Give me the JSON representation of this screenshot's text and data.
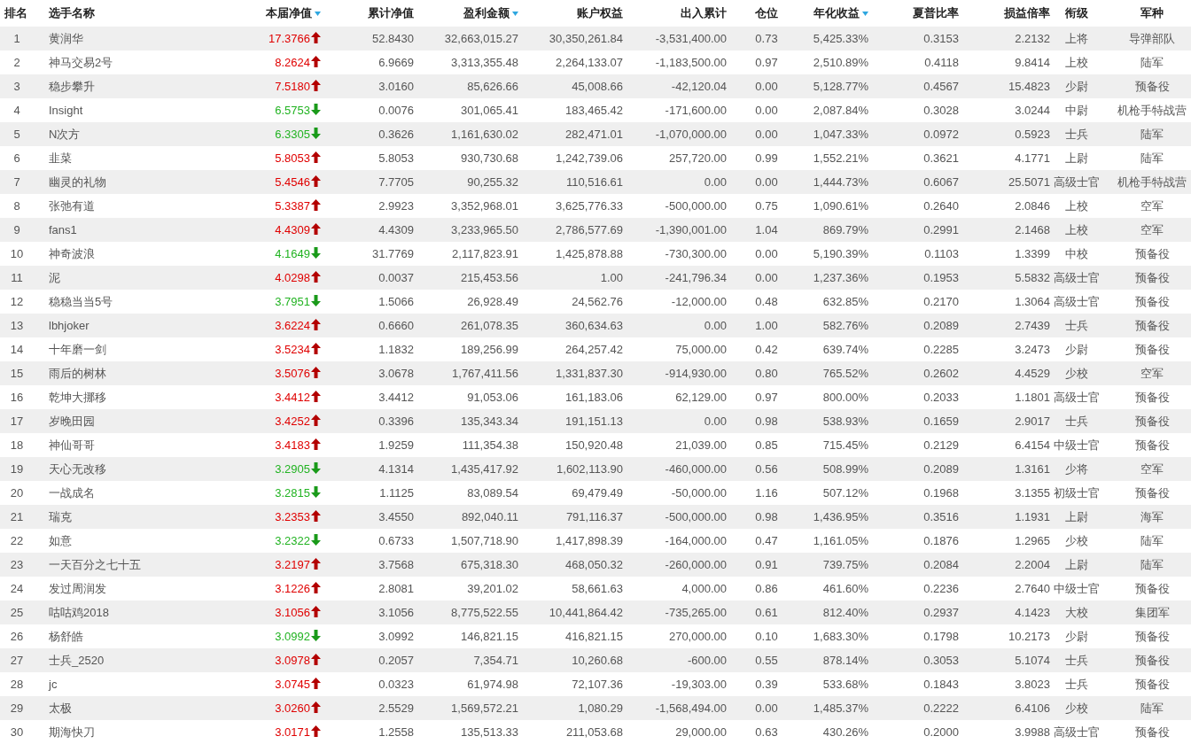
{
  "table": {
    "columns": [
      {
        "label": "排名",
        "sort_icon": false
      },
      {
        "label": "选手名称",
        "sort_icon": false
      },
      {
        "label": "本届净值",
        "sort_icon": true
      },
      {
        "label": "累计净值",
        "sort_icon": false
      },
      {
        "label": "盈利金额",
        "sort_icon": true
      },
      {
        "label": "账户权益",
        "sort_icon": false
      },
      {
        "label": "出入累计",
        "sort_icon": false
      },
      {
        "label": "仓位",
        "sort_icon": false
      },
      {
        "label": "年化收益",
        "sort_icon": true
      },
      {
        "label": "夏普比率",
        "sort_icon": false
      },
      {
        "label": "损益倍率",
        "sort_icon": false
      },
      {
        "label": "衔级",
        "sort_icon": false
      },
      {
        "label": "军种",
        "sort_icon": false
      }
    ],
    "rows": [
      {
        "rising": true,
        "cells": [
          "1",
          "黄润华",
          "17.3766",
          "52.8430",
          "32,663,015.27",
          "30,350,261.84",
          "-3,531,400.00",
          "0.73",
          "5,425.33%",
          "0.3153",
          "2.2132",
          "上将",
          "导弹部队"
        ]
      },
      {
        "rising": true,
        "cells": [
          "2",
          "神马交易2号",
          "8.2624",
          "6.9669",
          "3,313,355.48",
          "2,264,133.07",
          "-1,183,500.00",
          "0.97",
          "2,510.89%",
          "0.4118",
          "9.8414",
          "上校",
          "陆军"
        ]
      },
      {
        "rising": true,
        "cells": [
          "3",
          "稳步攀升",
          "7.5180",
          "3.0160",
          "85,626.66",
          "45,008.66",
          "-42,120.04",
          "0.00",
          "5,128.77%",
          "0.4567",
          "15.4823",
          "少尉",
          "预备役"
        ]
      },
      {
        "rising": false,
        "cells": [
          "4",
          "Insight",
          "6.5753",
          "0.0076",
          "301,065.41",
          "183,465.42",
          "-171,600.00",
          "0.00",
          "2,087.84%",
          "0.3028",
          "3.0244",
          "中尉",
          "机枪手特战营"
        ]
      },
      {
        "rising": false,
        "cells": [
          "5",
          "N次方",
          "6.3305",
          "0.3626",
          "1,161,630.02",
          "282,471.01",
          "-1,070,000.00",
          "0.00",
          "1,047.33%",
          "0.0972",
          "0.5923",
          "士兵",
          "陆军"
        ]
      },
      {
        "rising": true,
        "cells": [
          "6",
          "韭菜",
          "5.8053",
          "5.8053",
          "930,730.68",
          "1,242,739.06",
          "257,720.00",
          "0.99",
          "1,552.21%",
          "0.3621",
          "4.1771",
          "上尉",
          "陆军"
        ]
      },
      {
        "rising": true,
        "cells": [
          "7",
          "幽灵的礼物",
          "5.4546",
          "7.7705",
          "90,255.32",
          "110,516.61",
          "0.00",
          "0.00",
          "1,444.73%",
          "0.6067",
          "25.5071",
          "高级士官",
          "机枪手特战营"
        ]
      },
      {
        "rising": true,
        "cells": [
          "8",
          "张弛有道",
          "5.3387",
          "2.9923",
          "3,352,968.01",
          "3,625,776.33",
          "-500,000.00",
          "0.75",
          "1,090.61%",
          "0.2640",
          "2.0846",
          "上校",
          "空军"
        ]
      },
      {
        "rising": true,
        "cells": [
          "9",
          "fans1",
          "4.4309",
          "4.4309",
          "3,233,965.50",
          "2,786,577.69",
          "-1,390,001.00",
          "1.04",
          "869.79%",
          "0.2991",
          "2.1468",
          "上校",
          "空军"
        ]
      },
      {
        "rising": false,
        "cells": [
          "10",
          "神奇波浪",
          "4.1649",
          "31.7769",
          "2,117,823.91",
          "1,425,878.88",
          "-730,300.00",
          "0.00",
          "5,190.39%",
          "0.1103",
          "1.3399",
          "中校",
          "预备役"
        ]
      },
      {
        "rising": true,
        "cells": [
          "11",
          "泥",
          "4.0298",
          "0.0037",
          "215,453.56",
          "1.00",
          "-241,796.34",
          "0.00",
          "1,237.36%",
          "0.1953",
          "5.5832",
          "高级士官",
          "预备役"
        ]
      },
      {
        "rising": false,
        "cells": [
          "12",
          "稳稳当当5号",
          "3.7951",
          "1.5066",
          "26,928.49",
          "24,562.76",
          "-12,000.00",
          "0.48",
          "632.85%",
          "0.2170",
          "1.3064",
          "高级士官",
          "预备役"
        ]
      },
      {
        "rising": true,
        "cells": [
          "13",
          "lbhjoker",
          "3.6224",
          "0.6660",
          "261,078.35",
          "360,634.63",
          "0.00",
          "1.00",
          "582.76%",
          "0.2089",
          "2.7439",
          "士兵",
          "预备役"
        ]
      },
      {
        "rising": true,
        "cells": [
          "14",
          "十年磨一剑",
          "3.5234",
          "1.1832",
          "189,256.99",
          "264,257.42",
          "75,000.00",
          "0.42",
          "639.74%",
          "0.2285",
          "3.2473",
          "少尉",
          "预备役"
        ]
      },
      {
        "rising": true,
        "cells": [
          "15",
          "雨后的树林",
          "3.5076",
          "3.0678",
          "1,767,411.56",
          "1,331,837.30",
          "-914,930.00",
          "0.80",
          "765.52%",
          "0.2602",
          "4.4529",
          "少校",
          "空军"
        ]
      },
      {
        "rising": true,
        "cells": [
          "16",
          "乾坤大挪移",
          "3.4412",
          "3.4412",
          "91,053.06",
          "161,183.06",
          "62,129.00",
          "0.97",
          "800.00%",
          "0.2033",
          "1.1801",
          "高级士官",
          "预备役"
        ]
      },
      {
        "rising": true,
        "cells": [
          "17",
          "岁晚田园",
          "3.4252",
          "0.3396",
          "135,343.34",
          "191,151.13",
          "0.00",
          "0.98",
          "538.93%",
          "0.1659",
          "2.9017",
          "士兵",
          "预备役"
        ]
      },
      {
        "rising": true,
        "cells": [
          "18",
          "神仙哥哥",
          "3.4183",
          "1.9259",
          "111,354.38",
          "150,920.48",
          "21,039.00",
          "0.85",
          "715.45%",
          "0.2129",
          "6.4154",
          "中级士官",
          "预备役"
        ]
      },
      {
        "rising": false,
        "cells": [
          "19",
          "天心无改移",
          "3.2905",
          "4.1314",
          "1,435,417.92",
          "1,602,113.90",
          "-460,000.00",
          "0.56",
          "508.99%",
          "0.2089",
          "1.3161",
          "少将",
          "空军"
        ]
      },
      {
        "rising": false,
        "cells": [
          "20",
          "一战成名",
          "3.2815",
          "1.1125",
          "83,089.54",
          "69,479.49",
          "-50,000.00",
          "1.16",
          "507.12%",
          "0.1968",
          "3.1355",
          "初级士官",
          "预备役"
        ]
      },
      {
        "rising": true,
        "cells": [
          "21",
          "瑞克",
          "3.2353",
          "3.4550",
          "892,040.11",
          "791,116.37",
          "-500,000.00",
          "0.98",
          "1,436.95%",
          "0.3516",
          "1.1931",
          "上尉",
          "海军"
        ]
      },
      {
        "rising": false,
        "cells": [
          "22",
          "如意",
          "3.2322",
          "0.6733",
          "1,507,718.90",
          "1,417,898.39",
          "-164,000.00",
          "0.47",
          "1,161.05%",
          "0.1876",
          "1.2965",
          "少校",
          "陆军"
        ]
      },
      {
        "rising": true,
        "cells": [
          "23",
          "一天百分之七十五",
          "3.2197",
          "3.7568",
          "675,318.30",
          "468,050.32",
          "-260,000.00",
          "0.91",
          "739.75%",
          "0.2084",
          "2.2004",
          "上尉",
          "陆军"
        ]
      },
      {
        "rising": true,
        "cells": [
          "24",
          "发过周润发",
          "3.1226",
          "2.8081",
          "39,201.02",
          "58,661.63",
          "4,000.00",
          "0.86",
          "461.60%",
          "0.2236",
          "2.7640",
          "中级士官",
          "预备役"
        ]
      },
      {
        "rising": true,
        "cells": [
          "25",
          "咕咕鸡2018",
          "3.1056",
          "3.1056",
          "8,775,522.55",
          "10,441,864.42",
          "-735,265.00",
          "0.61",
          "812.40%",
          "0.2937",
          "4.1423",
          "大校",
          "集团军"
        ]
      },
      {
        "rising": false,
        "cells": [
          "26",
          "杨舒皓",
          "3.0992",
          "3.0992",
          "146,821.15",
          "416,821.15",
          "270,000.00",
          "0.10",
          "1,683.30%",
          "0.1798",
          "10.2173",
          "少尉",
          "预备役"
        ]
      },
      {
        "rising": true,
        "cells": [
          "27",
          "士兵_2520",
          "3.0978",
          "0.2057",
          "7,354.71",
          "10,260.68",
          "-600.00",
          "0.55",
          "878.14%",
          "0.3053",
          "5.1074",
          "士兵",
          "预备役"
        ]
      },
      {
        "rising": true,
        "cells": [
          "28",
          "jc",
          "3.0745",
          "0.0323",
          "61,974.98",
          "72,107.36",
          "-19,303.00",
          "0.39",
          "533.68%",
          "0.1843",
          "3.8023",
          "士兵",
          "预备役"
        ]
      },
      {
        "rising": true,
        "cells": [
          "29",
          "太极",
          "3.0260",
          "2.5529",
          "1,569,572.21",
          "1,080.29",
          "-1,568,494.00",
          "0.00",
          "1,485.37%",
          "0.2222",
          "6.4106",
          "少校",
          "陆军"
        ]
      },
      {
        "rising": true,
        "cells": [
          "30",
          "期海快刀",
          "3.0171",
          "1.2558",
          "135,513.33",
          "211,053.68",
          "29,000.00",
          "0.63",
          "430.26%",
          "0.2000",
          "3.9988",
          "高级士官",
          "预备役"
        ]
      }
    ]
  }
}
